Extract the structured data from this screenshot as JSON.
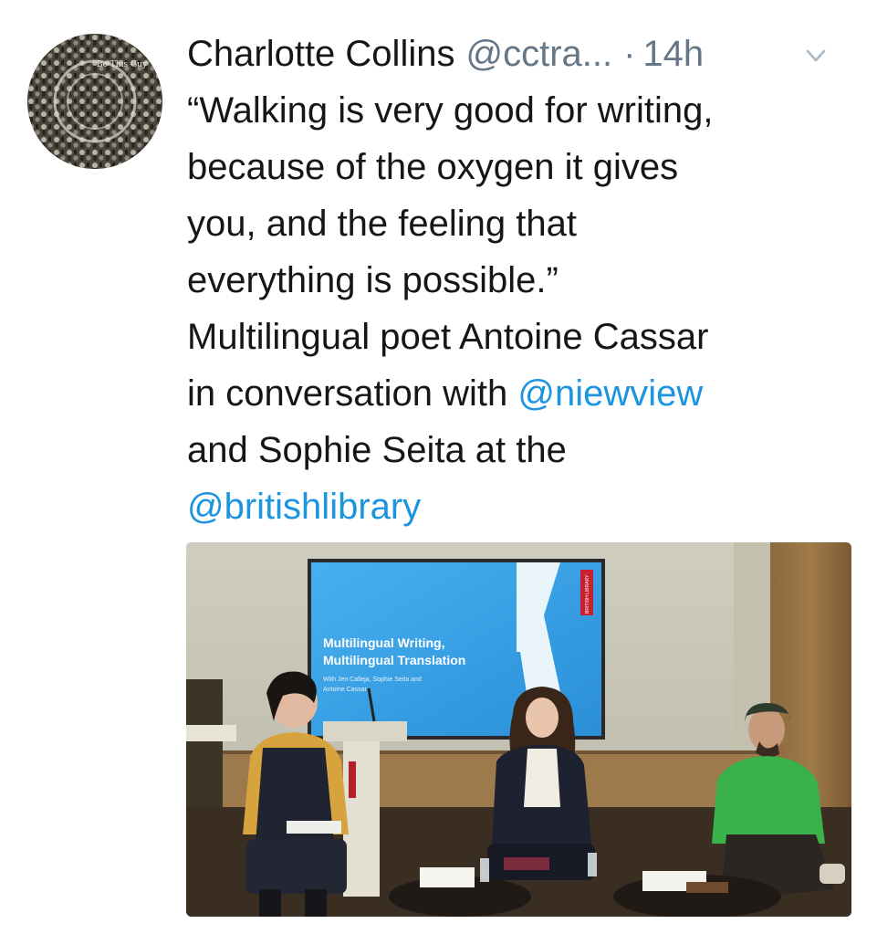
{
  "tweet": {
    "author_name": "Charlotte Collins",
    "author_handle": "@cctra...",
    "separator": "·",
    "timestamp": "14h",
    "text_lines": [
      "“Walking is very good for writing,",
      "because of the oxygen it gives",
      "you, and the feeling that",
      "everything is possible.”",
      "Multilingual poet Antoine Cassar"
    ],
    "line6_prefix": "in conversation with ",
    "mention_1": "@niewview",
    "line7": "and Sophie Seita at the",
    "mention_2": "@britishlibrary"
  },
  "avatar": {
    "label": "Be This Guy"
  },
  "photo": {
    "screen_title_1": "Multilingual Writing,",
    "screen_title_2": "Multilingual Translation",
    "screen_sub_1": "With Jen Calleja, Sophie Seita and",
    "screen_sub_2": "Antoine Cassar",
    "logo_text": "BRITISH LIBRARY"
  },
  "colors": {
    "link": "#1b95e0",
    "muted": "#657786",
    "text": "#14171a",
    "screen_blue": "#3aa0e8",
    "logo_red": "#c8202f"
  },
  "icons": {
    "chevron": "chevron-down-icon"
  }
}
